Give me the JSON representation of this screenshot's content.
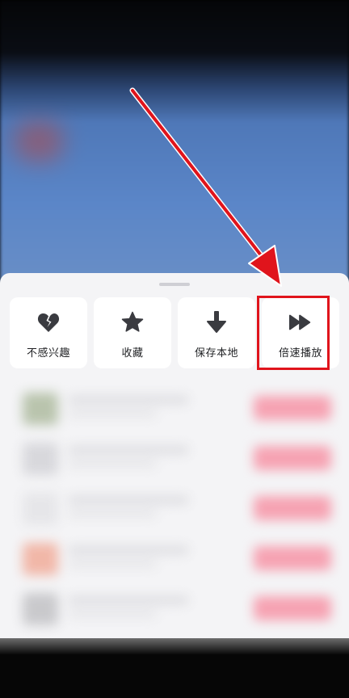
{
  "sheet": {
    "actions": [
      {
        "label": "不感兴趣",
        "icon": "broken-heart-icon"
      },
      {
        "label": "收藏",
        "icon": "star-icon"
      },
      {
        "label": "保存本地",
        "icon": "download-arrow-icon"
      },
      {
        "label": "倍速播放",
        "icon": "fast-forward-icon"
      }
    ]
  },
  "annotation": {
    "color": "#e0141c",
    "highlighted": "倍速播放"
  }
}
